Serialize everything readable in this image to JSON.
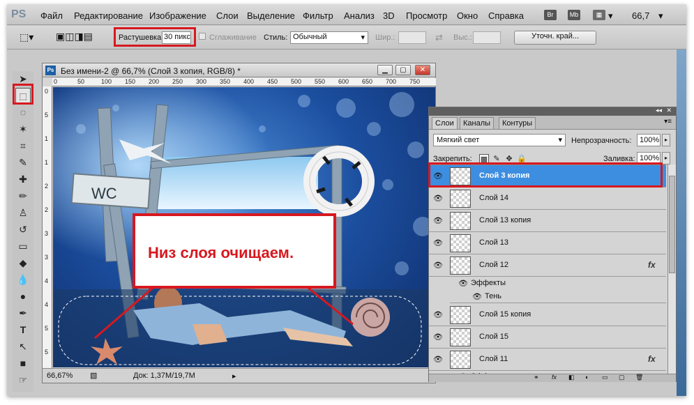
{
  "menubar": {
    "logo": "PS",
    "items": [
      "Файл",
      "Редактирование",
      "Изображение",
      "Слои",
      "Выделение",
      "Фильтр",
      "Анализ",
      "3D",
      "Просмотр",
      "Окно",
      "Справка"
    ],
    "bridge": "Br",
    "mini": "Mb",
    "zoom": "66,7"
  },
  "options": {
    "feather_label": "Растушевка:",
    "feather_value": "30 пикс",
    "antialias_label": "Сглаживание",
    "style_label": "Стиль:",
    "style_value": "Обычный",
    "width_label": "Шир.:",
    "height_label": "Выс.:",
    "refine_edge": "Уточн. край..."
  },
  "document": {
    "title": "Без имени-2 @ 66,7% (Слой 3 копия, RGB/8) *",
    "ps_icon": "Ps",
    "ruler_top": [
      "0",
      "50",
      "100",
      "150",
      "200",
      "250",
      "300",
      "350",
      "400",
      "450",
      "500",
      "550",
      "600",
      "650",
      "700",
      "750"
    ],
    "ruler_left": [
      "0",
      "5",
      "1",
      "1",
      "2",
      "2",
      "3",
      "3",
      "4",
      "4",
      "5",
      "5"
    ],
    "status_zoom": "66,67%",
    "status_doc": "Док: 1,37M/19,7M",
    "sign_text": "WC"
  },
  "callout": {
    "text": "Низ слоя очищаем."
  },
  "layers": {
    "tabs": [
      "Слои",
      "Каналы",
      "Контуры"
    ],
    "blend_mode": "Мягкий свет",
    "opacity_label": "Непрозрачность:",
    "opacity_value": "100%",
    "lock_label": "Закрепить:",
    "fill_label": "Заливка:",
    "fill_value": "100%",
    "rows": [
      {
        "name": "Слой 3 копия",
        "selected": true
      },
      {
        "name": "Слой 14"
      },
      {
        "name": "Слой 13 копия"
      },
      {
        "name": "Слой 13"
      },
      {
        "name": "Слой 12",
        "fx": "fx"
      },
      {
        "name": "Слой 15 копия"
      },
      {
        "name": "Слой 15"
      },
      {
        "name": "Слой 11",
        "fx": "fx"
      }
    ],
    "effects_label": "Эффекты",
    "shadow_label": "Тень"
  },
  "colors": {
    "highlight": "#d7181f",
    "selection": "#3d8ee0"
  },
  "icons": [
    "eye-icon",
    "marquee-tool-icon",
    "move-tool-icon",
    "lasso-tool-icon",
    "crop-tool-icon",
    "brush-tool-icon",
    "type-tool-icon",
    "lock-icon",
    "chain-icon"
  ]
}
